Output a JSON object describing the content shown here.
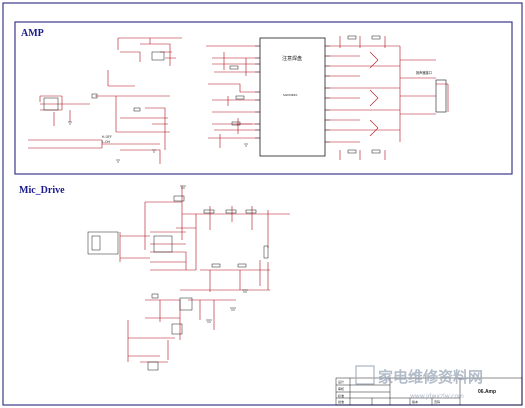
{
  "sections": {
    "amp_title": "AMP",
    "mic_title": "Mic_Drive"
  },
  "chip": {
    "label_cn": "注意焊盘",
    "part": "SGM4810"
  },
  "misc_labels": {
    "hoff": "H-OFF",
    "loh": "L-OH",
    "speaker": "扬声器接口"
  },
  "title_block": {
    "sheet_name": "06.Amp",
    "fields": [
      "设计",
      "审核",
      "标准",
      "批准",
      "版本",
      "页码"
    ]
  },
  "watermark": {
    "site_cn": "家电维修资料网",
    "url": "www.jdwxzlw.com"
  },
  "colors": {
    "border": "#3a3a8a",
    "wire": "#b0101c",
    "component": "#1a1a1a",
    "title": "#1a1a8c"
  }
}
